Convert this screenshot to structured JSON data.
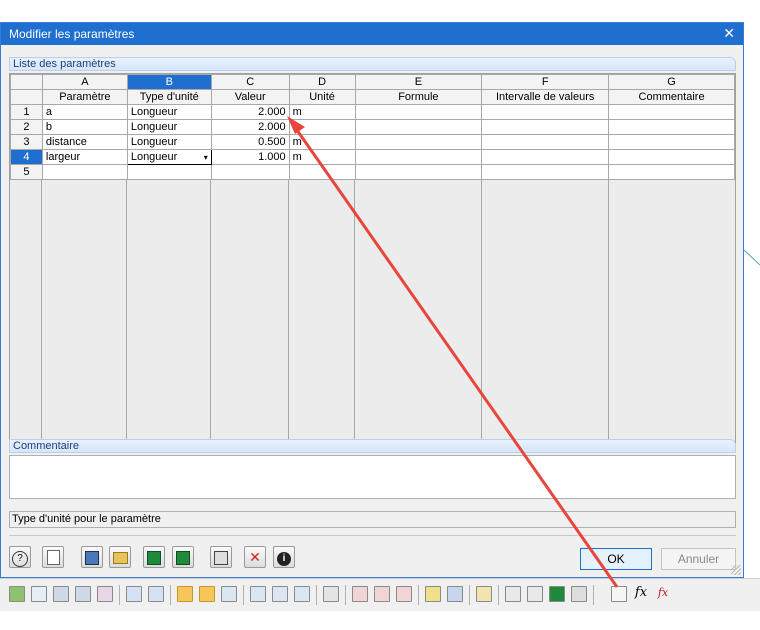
{
  "dialog": {
    "title": "Modifier les paramètres",
    "close_symbol": "✕",
    "list_title": "Liste des paramètres",
    "comment_title": "Commentaire",
    "status_text": "Type d'unité pour le paramètre",
    "ok_label": "OK",
    "cancel_label": "Annuler"
  },
  "grid": {
    "col_letters": [
      "A",
      "B",
      "C",
      "D",
      "E",
      "F",
      "G"
    ],
    "col_headers": [
      "Paramètre",
      "Type d'unité",
      "Valeur",
      "Unité",
      "Formule",
      "Intervalle de valeurs",
      "Commentaire"
    ],
    "rows": [
      {
        "num": "1",
        "param": "a",
        "type": "Longueur",
        "value": "2.000",
        "unit": "m"
      },
      {
        "num": "2",
        "param": "b",
        "type": "Longueur",
        "value": "2.000",
        "unit": "m"
      },
      {
        "num": "3",
        "param": "distance",
        "type": "Longueur",
        "value": "0.500",
        "unit": "m"
      },
      {
        "num": "4",
        "param": "largeur",
        "type": "Longueur",
        "value": "1.000",
        "unit": "m"
      },
      {
        "num": "5",
        "param": "",
        "type": "",
        "value": "",
        "unit": ""
      }
    ],
    "combo_arrow": "▾"
  },
  "colors": {
    "title_bar": "#1e6fd0",
    "selection": "#1e6fd0",
    "annotation_arrow": "#e8453c"
  },
  "icons": {
    "bottom_buttons": [
      "help-icon",
      "edit-icon",
      "save-icon",
      "open-icon",
      "excel-export-icon",
      "excel-import-icon",
      "calculator-icon",
      "delete-icon",
      "info-icon"
    ],
    "help": "?",
    "info": "i",
    "delete": "✕",
    "fx": "fx"
  }
}
